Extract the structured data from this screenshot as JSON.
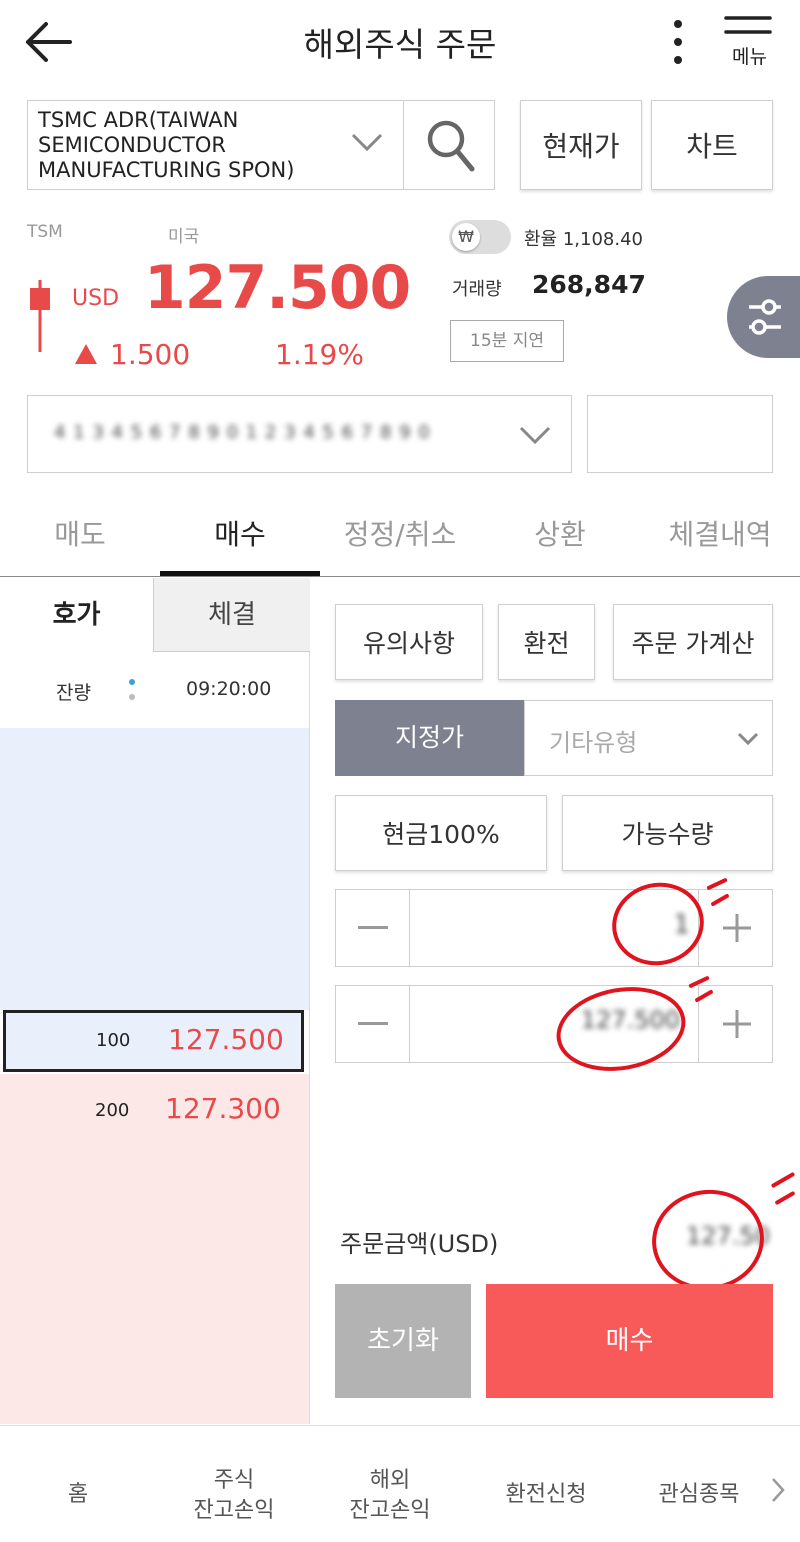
{
  "header": {
    "title": "해외주식 주문",
    "menu_label": "메뉴"
  },
  "stock": {
    "name": "TSMC ADR(TAIWAN SEMICONDUCTOR MANUFACTURING SPON)",
    "ticker": "TSM",
    "market": "미국",
    "currency": "USD",
    "price": "127.500",
    "change": "1.500",
    "change_pct": "1.19%",
    "fx_label": "환율 1,108.40",
    "fx_toggle_symbol": "₩",
    "volume_label": "거래량",
    "volume": "268,847",
    "delay_badge": "15분 지연"
  },
  "buttons": {
    "current_price": "현재가",
    "chart": "차트"
  },
  "account": {
    "masked": "4 1 3 4 5 6 7 8 9 0 1 2 3 4 5 6 7 8 9 0"
  },
  "tabs": [
    {
      "label": "매도",
      "active": false
    },
    {
      "label": "매수",
      "active": true
    },
    {
      "label": "정정/취소",
      "active": false
    },
    {
      "label": "상환",
      "active": false
    },
    {
      "label": "체결내역",
      "active": false
    }
  ],
  "orderbook": {
    "tabs": [
      "호가",
      "체결"
    ],
    "remain_label": "잔량",
    "time": "09:20:00",
    "rows": [
      {
        "qty": "100",
        "price": "127.500",
        "selected": true
      },
      {
        "qty": "200",
        "price": "127.300",
        "selected": false
      }
    ]
  },
  "order": {
    "notice": "유의사항",
    "exchange": "환전",
    "calculator": "주문 가계산",
    "limit": "지정가",
    "other_type": "기타유형",
    "cash100": "현금100%",
    "avail_qty": "가능수량",
    "qty_value": "1",
    "price_value": "127.500",
    "amount_label": "주문금액(USD)",
    "amount_value": "127.50",
    "reset": "초기화",
    "buy": "매수"
  },
  "bottom_nav": [
    {
      "line1": "홈",
      "line2": ""
    },
    {
      "line1": "주식",
      "line2": "잔고손익"
    },
    {
      "line1": "해외",
      "line2": "잔고손익"
    },
    {
      "line1": "환전신청",
      "line2": ""
    },
    {
      "line1": "관심종목",
      "line2": ""
    }
  ],
  "colors": {
    "up": "#e84a4a",
    "buy": "#f85a5a",
    "limit_bg": "#7d8190",
    "bid_bg": "#eaf0fb",
    "ask_bg": "#fde8e8"
  }
}
